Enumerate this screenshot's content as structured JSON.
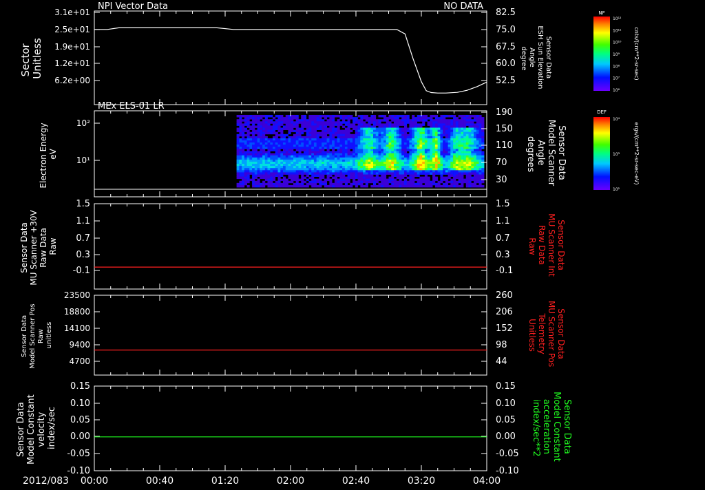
{
  "date_label": "2012/083",
  "time_ticks": [
    "00:00",
    "00:40",
    "01:20",
    "02:00",
    "02:40",
    "03:20",
    "04:00"
  ],
  "colors": {
    "white": "#ffffff",
    "red": "#ff2020",
    "green": "#20ff20"
  },
  "colorbars": [
    {
      "label": "NF",
      "unit": "cnts/(cm**2-sr-sec)",
      "ticks": [
        "10¹²",
        "10¹¹",
        "10¹⁰",
        "10⁹",
        "10⁸",
        "10⁷",
        "10⁶"
      ]
    },
    {
      "label": "DEF",
      "unit": "ergs/(cm**2-sr-sec-eV)",
      "ticks": [
        "10⁴",
        "10³",
        "10²"
      ]
    }
  ],
  "chart_data": [
    {
      "type": "line",
      "title_left": "NPI Vector Data",
      "title_right": "NO DATA",
      "ylabel_left": [
        "Sector",
        "Unitless"
      ],
      "ylabel_right": [
        "Sensor Data",
        "ESH Sun Elevation",
        "Angle",
        "degree"
      ],
      "left_ticks": [
        "3.1e+01",
        "2.5e+01",
        "1.9e+01",
        "1.2e+01",
        "6.2e+00"
      ],
      "right_ticks": [
        "82.5",
        "75.0",
        "67.5",
        "60.0",
        "52.5"
      ],
      "ylim_right": [
        45,
        82.5
      ],
      "xlim_min": [
        0,
        240
      ],
      "series": [
        {
          "x": [
            0,
            8,
            15,
            60,
            75,
            85,
            115,
            185,
            190,
            195,
            200,
            203,
            206,
            210,
            215,
            222,
            228,
            234,
            240
          ],
          "y": [
            75,
            75,
            75.7,
            75.7,
            75.7,
            75,
            75,
            75,
            73,
            62,
            52,
            48,
            47.2,
            47,
            47,
            47.3,
            48.2,
            49.8,
            51.8
          ]
        }
      ]
    },
    {
      "type": "heatmap",
      "title": "MEx ELS-01 LR",
      "ylabel_left": [
        "Electron Energy",
        "eV"
      ],
      "ylabel_right": [
        "Sensor Data",
        "Model Scanner",
        "Angle",
        "degrees"
      ],
      "left_ticks": [
        "10²",
        "10¹"
      ],
      "right_ticks": [
        "190",
        "150",
        "110",
        "70",
        "30"
      ],
      "data_start_min": 87
    },
    {
      "type": "line",
      "ylabel_left": [
        "Sensor Data",
        "MU Scanner +30V",
        "Raw Data",
        "Raw"
      ],
      "ylabel_right": [
        "Sensor Data",
        "MU Scanner Int",
        "Raw Data",
        "Raw"
      ],
      "left_ticks": [
        "1.5",
        "1.1",
        "0.7",
        "0.3",
        "-0.1"
      ],
      "right_ticks": [
        "1.5",
        "1.1",
        "0.7",
        "0.3",
        "-0.1"
      ],
      "ylim": [
        -0.3,
        1.5
      ],
      "series": [
        {
          "color": "red",
          "x": [
            0,
            240
          ],
          "y": [
            -0.02,
            -0.02
          ]
        }
      ]
    },
    {
      "type": "line",
      "ylabel_left": [
        "Sensor Data",
        "Model Scanner Pos",
        "Raw",
        "unitless"
      ],
      "ylabel_right": [
        "Sensor Data",
        "MU Scanner Pos",
        "Telemetry",
        "Unitless"
      ],
      "left_ticks": [
        "23500",
        "18800",
        "14100",
        "9400",
        "4700"
      ],
      "right_ticks": [
        "260",
        "206",
        "152",
        "98",
        "44"
      ],
      "ylim_right": [
        0,
        260
      ],
      "series": [
        {
          "color": "red",
          "x": [
            0,
            240
          ],
          "y": [
            81,
            81
          ]
        }
      ]
    },
    {
      "type": "line",
      "ylabel_left": [
        "Sensor Data",
        "Model Constant",
        "velocity",
        "index/sec"
      ],
      "ylabel_right": [
        "Sensor Data",
        "Model Constant",
        "acceleration",
        "index/sec**2"
      ],
      "left_ticks": [
        "0.15",
        "0.10",
        "0.05",
        "0.00",
        "-0.05",
        "-0.10"
      ],
      "right_ticks": [
        "0.15",
        "0.10",
        "0.05",
        "0.00",
        "-0.05",
        "-0.10"
      ],
      "ylim": [
        -0.1,
        0.15
      ],
      "series": [
        {
          "color": "green",
          "x": [
            0,
            240
          ],
          "y": [
            0,
            0
          ]
        }
      ]
    }
  ]
}
